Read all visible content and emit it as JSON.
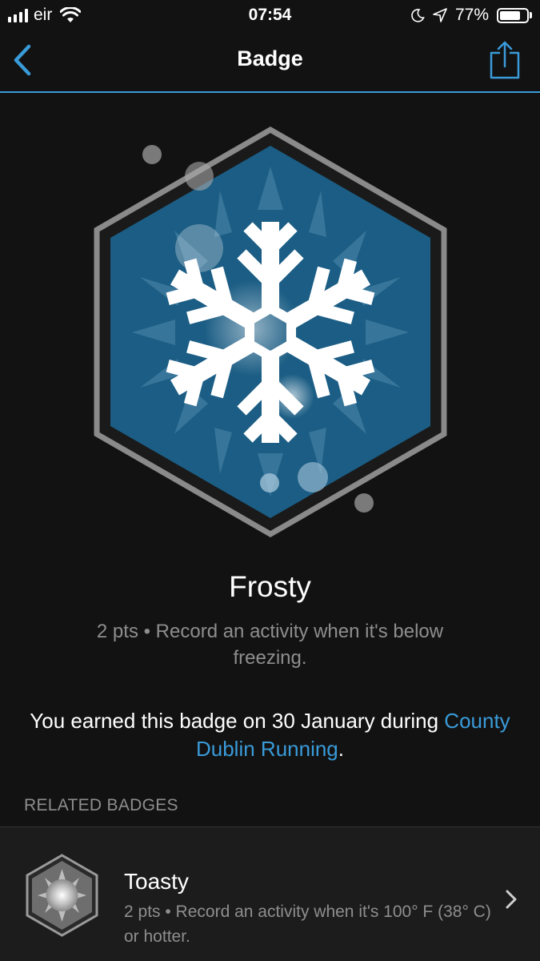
{
  "status_bar": {
    "carrier": "eir",
    "time": "07:54",
    "battery_percent": "77%",
    "battery_level": 0.77
  },
  "nav": {
    "title": "Badge",
    "back_icon": "chevron-left-icon",
    "share_icon": "share-icon"
  },
  "badge": {
    "name": "Frosty",
    "description": "2 pts • Record an activity when it's below freezing.",
    "earned_prefix": "You earned this badge on 30 January during ",
    "earned_link": "County Dublin Running",
    "earned_suffix": ".",
    "icon": "snowflake-icon"
  },
  "related": {
    "header": "RELATED BADGES",
    "items": [
      {
        "title": "Toasty",
        "description": "2 pts • Record an activity when it's 100° F (38° C) or hotter.",
        "icon": "sun-badge-icon"
      }
    ]
  },
  "colors": {
    "accent": "#3a9bd9",
    "background": "#121212",
    "badge_blue": "#1b5d84",
    "muted_text": "#8e8e8e"
  }
}
